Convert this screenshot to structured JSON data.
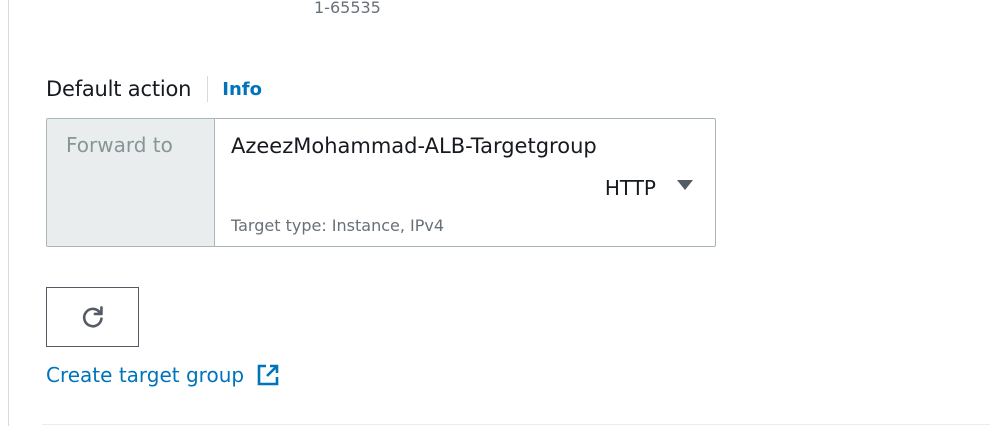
{
  "port": {
    "hint": "1-65535"
  },
  "default_action": {
    "label": "Default action",
    "info_link": "Info",
    "action_type": "Forward to",
    "target_group": {
      "name": "AzeezMohammad-ALB-Targetgroup",
      "protocol": "HTTP",
      "details": "Target type: Instance, IPv4"
    }
  },
  "refresh_button": {
    "icon": "refresh-icon"
  },
  "create_target_group": {
    "label": "Create target group",
    "icon": "external-link-icon"
  },
  "colors": {
    "link": "#0073bb",
    "text": "#16191f",
    "muted": "#687078",
    "border": "#aab7b8",
    "panel": "#eaeded"
  }
}
